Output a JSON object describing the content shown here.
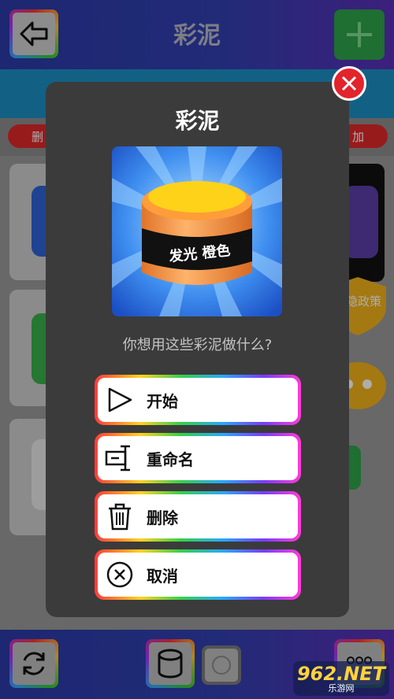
{
  "app": {
    "title": "彩泥",
    "back_icon": "arrow-left-icon",
    "add_icon": "plus-icon"
  },
  "toolbar": {
    "delete_label": "删",
    "add_label": "加"
  },
  "side": {
    "privacy_label": "私隐政策"
  },
  "dialog": {
    "title": "彩泥",
    "jar_label": "发光 橙色",
    "question": "你想用这些彩泥做什么?",
    "actions": [
      {
        "label": "开始",
        "icon": "play-icon"
      },
      {
        "label": "重命名",
        "icon": "rename-cursor-icon"
      },
      {
        "label": "删除",
        "icon": "trash-icon"
      },
      {
        "label": "取消",
        "icon": "cancel-circle-x-icon"
      }
    ]
  },
  "bottom": {
    "refresh_icon": "refresh-icon",
    "storage_icon": "database-icon",
    "circle_icon": "circle-icon",
    "grid_icon": "dots-grid-icon"
  },
  "watermark": {
    "main": "962.NET",
    "sub": "乐游网"
  },
  "colors": {
    "accent_green": "#2ea34a",
    "danger_red": "#e2242c",
    "dialog_bg": "#3b3b3b",
    "topbar_blue": "#3140b0"
  }
}
